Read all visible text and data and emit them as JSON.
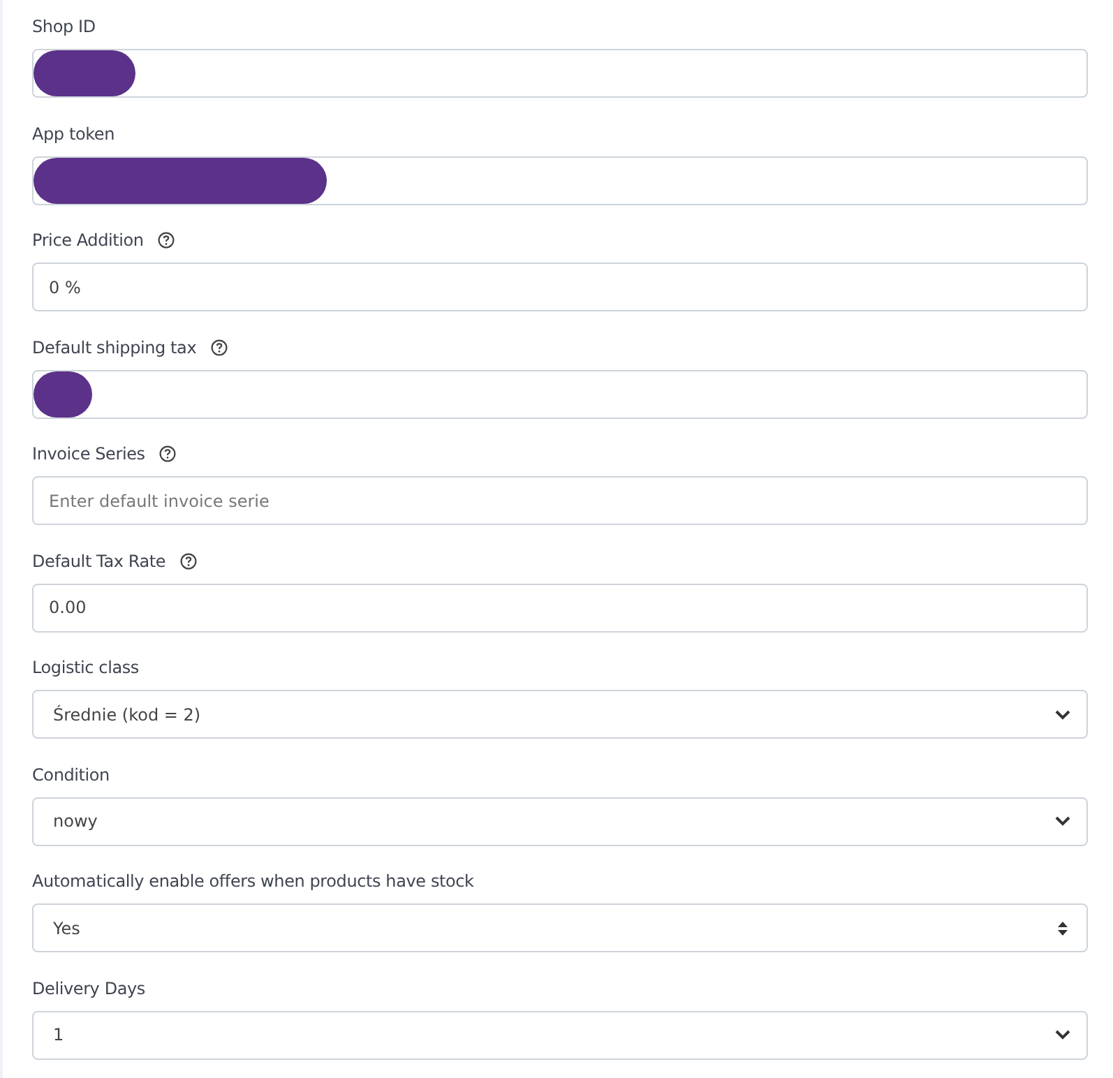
{
  "fields": [
    {
      "label": "Shop ID",
      "kind": "text",
      "redacted": true
    },
    {
      "label": "App token",
      "kind": "text",
      "redacted": true
    },
    {
      "label": "Price Addition",
      "help": true,
      "kind": "text",
      "value": "0 %"
    },
    {
      "label": "Default shipping tax",
      "help": true,
      "kind": "text",
      "redacted": true
    },
    {
      "label": "Invoice Series",
      "help": true,
      "kind": "text",
      "placeholder": "Enter default invoice serie"
    },
    {
      "label": "Default Tax Rate",
      "help": true,
      "kind": "text",
      "value": "0.00"
    },
    {
      "label": "Logistic class",
      "kind": "select",
      "value": "Średnie (kod = 2)"
    },
    {
      "label": "Condition",
      "kind": "select",
      "value": "nowy"
    },
    {
      "label": "Automatically enable offers when products have stock",
      "kind": "updown",
      "value": "Yes"
    },
    {
      "label": "Delivery Days",
      "kind": "select",
      "value": "1"
    }
  ]
}
